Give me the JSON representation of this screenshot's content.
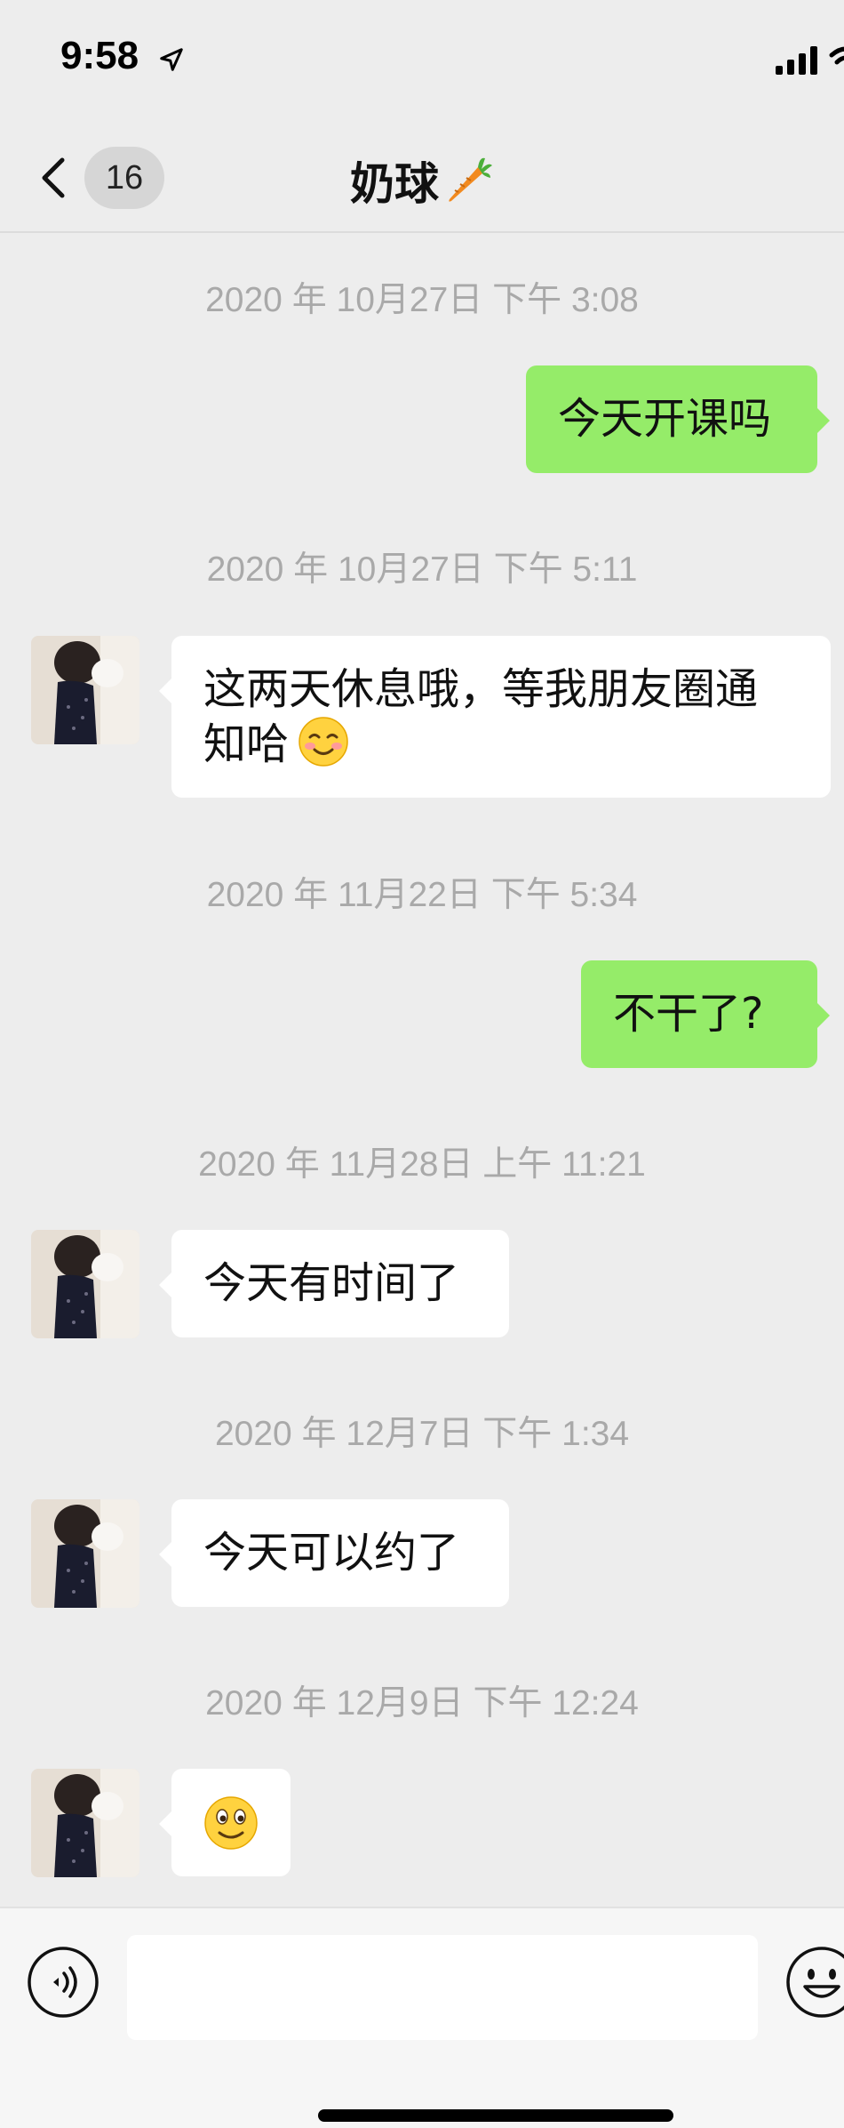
{
  "status_bar": {
    "time": "9:58"
  },
  "nav": {
    "unread_count": "16",
    "title": "奶球"
  },
  "messages": [
    {
      "timestamp": "2020 年 10月27日 下午 3:08",
      "sender": "me",
      "text": "今天开课吗"
    },
    {
      "timestamp": "2020 年 10月27日 下午 5:11",
      "sender": "contact",
      "text_line1": "这两天休息哦，等我朋友圈通",
      "text_line2": "知哈"
    },
    {
      "timestamp": "2020 年 11月22日 下午 5:34",
      "sender": "me",
      "text": "不干了?"
    },
    {
      "timestamp": "2020 年 11月28日 上午 11:21",
      "sender": "contact",
      "text": "今天有时间了"
    },
    {
      "timestamp": "2020 年 12月7日 下午 1:34",
      "sender": "contact",
      "text": "今天可以约了"
    },
    {
      "timestamp": "2020 年 12月9日 下午 12:24",
      "sender": "contact",
      "emoji": "smile-emoji"
    }
  ],
  "input": {
    "value": "",
    "placeholder": ""
  },
  "icons": {
    "back": "chevron-left-icon",
    "voice": "voice-icon",
    "emoji": "emoji-icon",
    "carrot": "carrot-icon"
  },
  "colors": {
    "outgoing_bubble": "#95ec69",
    "incoming_bubble": "#ffffff",
    "background": "#ededed",
    "timestamp_text": "#a9a9a9"
  }
}
